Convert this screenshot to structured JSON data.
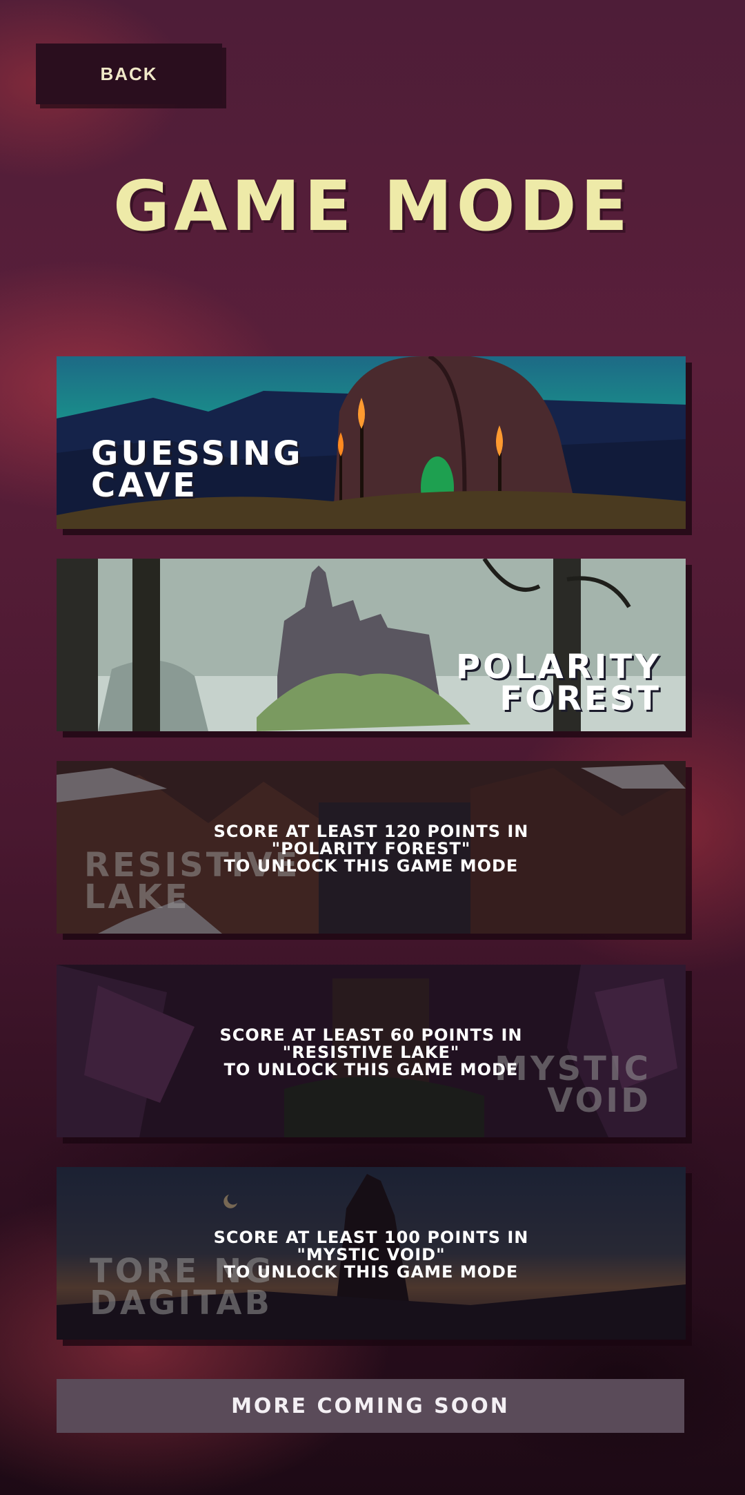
{
  "back_button": {
    "label": "BACK"
  },
  "title": "GAME MODE",
  "modes": [
    {
      "name_line1": "GUESSING",
      "name_line2": "CAVE",
      "locked": false
    },
    {
      "name_line1": "POLARITY",
      "name_line2": "FOREST",
      "locked": false
    },
    {
      "name_line1": "RESISTIVE",
      "name_line2": "LAKE",
      "locked": true,
      "lock_line1": "SCORE AT LEAST 120 POINTS IN",
      "lock_line2": "\"POLARITY FOREST\"",
      "lock_line3": "TO UNLOCK THIS GAME MODE"
    },
    {
      "name_line1": "MYSTIC",
      "name_line2": "VOID",
      "locked": true,
      "lock_line1": "SCORE AT LEAST 60 POINTS IN",
      "lock_line2": "\"RESISTIVE LAKE\"",
      "lock_line3": "TO UNLOCK THIS GAME MODE"
    },
    {
      "name_line1": "TORE NG",
      "name_line2": "DAGITAB",
      "locked": true,
      "lock_line1": "SCORE AT LEAST 100 POINTS IN",
      "lock_line2": "\"MYSTIC VOID\"",
      "lock_line3": "TO UNLOCK THIS GAME MODE"
    }
  ],
  "more_label": "MORE COMING SOON"
}
